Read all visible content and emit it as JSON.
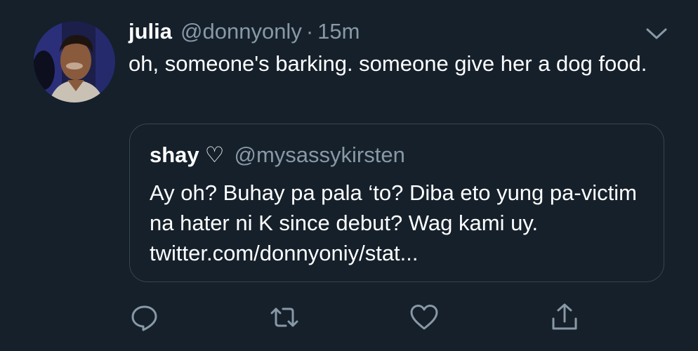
{
  "tweet": {
    "display_name": "julia",
    "handle": "@donnyonly",
    "separator": "·",
    "time": "15m",
    "text": "oh, someone's barking. someone give her a dog food.",
    "menu_icon": "chevron-down-icon"
  },
  "quote": {
    "display_name": "shay",
    "name_emoji": "♡",
    "handle": "@mysassykirsten",
    "text": "Ay oh? Buhay pa pala ‘to? Diba eto yung pa-victim na hater ni K since debut? Wag kami uy. twitter.com/donnyoniy/stat..."
  },
  "actions": [
    {
      "name": "reply",
      "icon": "reply-icon"
    },
    {
      "name": "retweet",
      "icon": "retweet-icon"
    },
    {
      "name": "like",
      "icon": "heart-icon"
    },
    {
      "name": "share",
      "icon": "share-icon"
    }
  ],
  "colors": {
    "background": "#15202b",
    "primary_text": "#ffffff",
    "secondary_text": "#8899a6",
    "border": "#38444d"
  }
}
